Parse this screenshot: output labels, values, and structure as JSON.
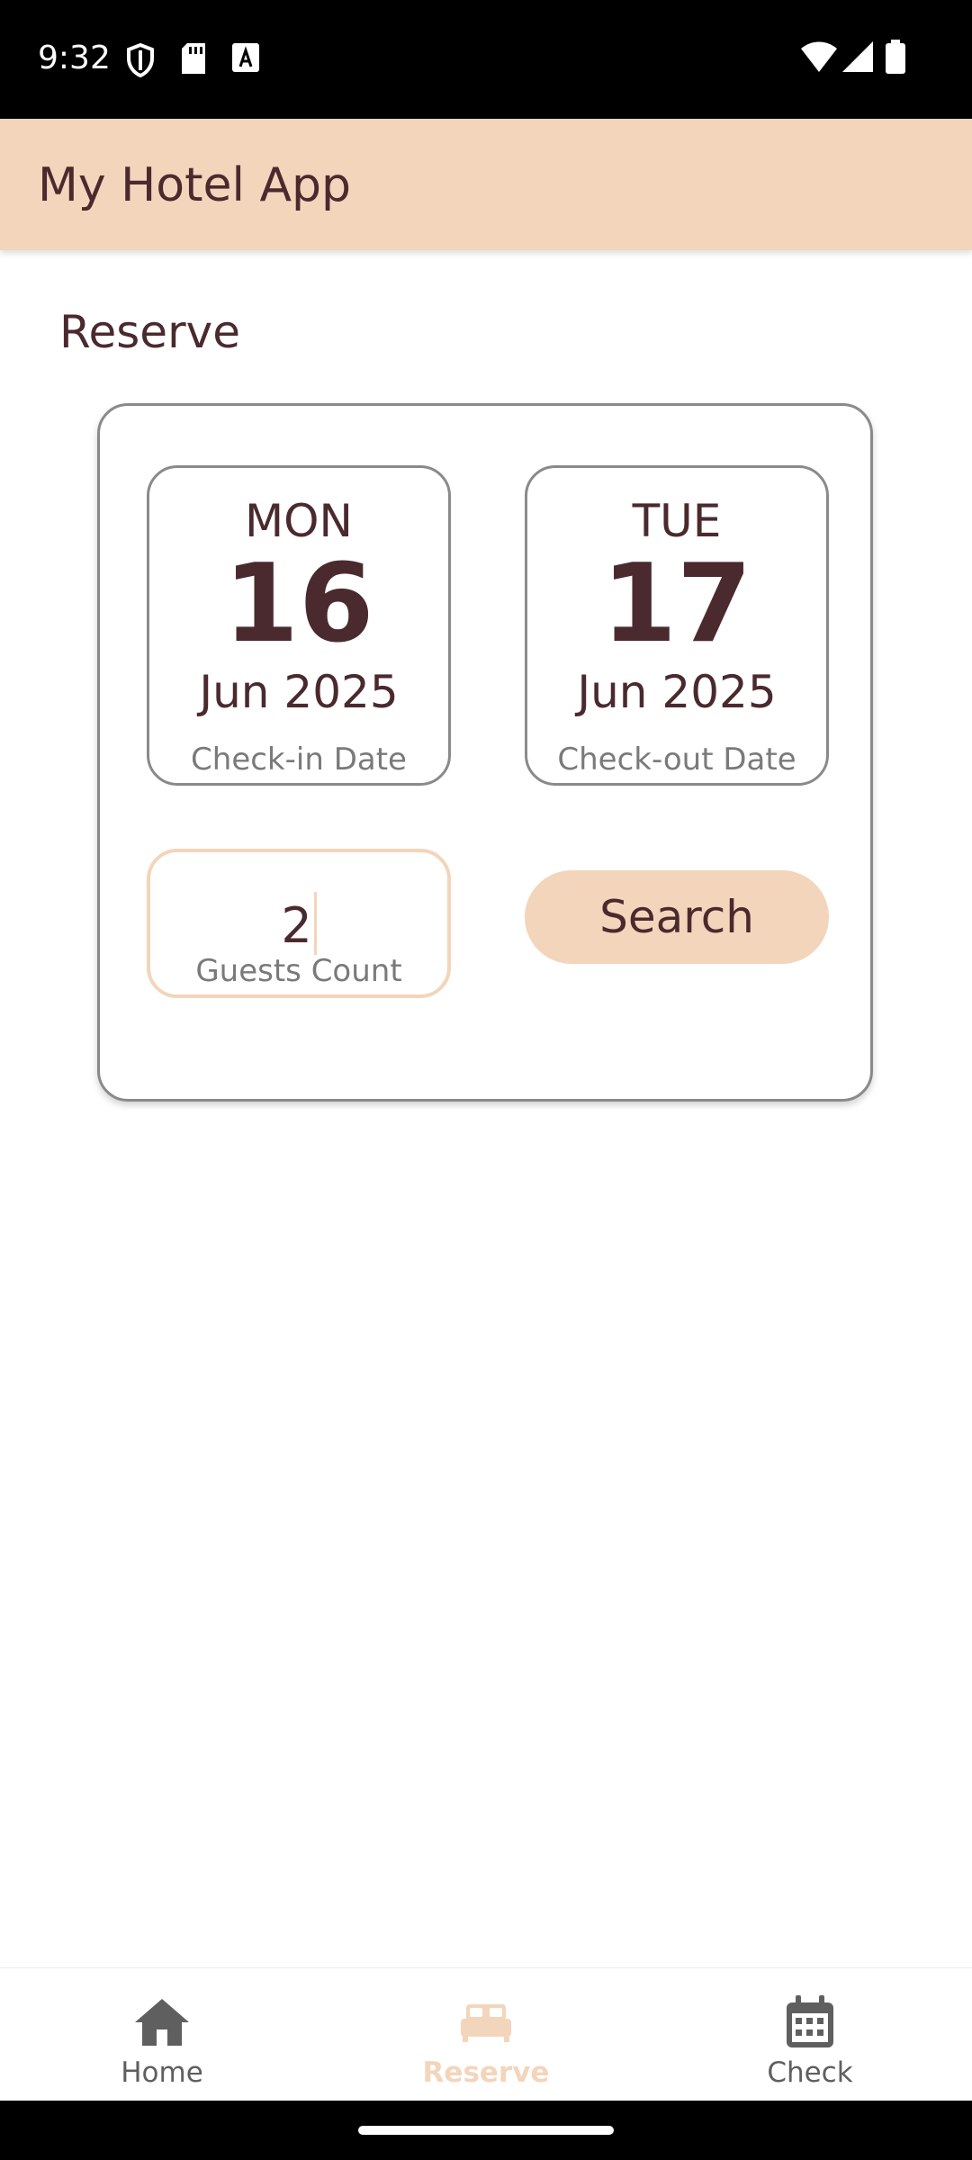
{
  "status_bar": {
    "time": "9:32",
    "left_icons": [
      "shield-icon",
      "sd-card-icon",
      "font-a-icon"
    ],
    "right_icons": [
      "wifi-icon",
      "cell-signal-icon",
      "battery-icon"
    ]
  },
  "app_bar": {
    "title": "My Hotel App"
  },
  "section": {
    "title": "Reserve"
  },
  "checkin": {
    "dow": "MON",
    "day": "16",
    "month_year": "Jun 2025",
    "label": "Check-in Date"
  },
  "checkout": {
    "dow": "TUE",
    "day": "17",
    "month_year": "Jun 2025",
    "label": "Check-out Date"
  },
  "guests": {
    "value": "2",
    "label": "Guests Count"
  },
  "search": {
    "label": "Search"
  },
  "bottom_nav": {
    "items": [
      {
        "label": "Home",
        "icon": "home-icon",
        "active": false
      },
      {
        "label": "Reserve",
        "icon": "bed-icon",
        "active": true
      },
      {
        "label": "Check",
        "icon": "calendar-icon",
        "active": false
      }
    ]
  },
  "colors": {
    "accent": "#f3d5bb",
    "text": "#4a2a2e",
    "muted": "#7a7a7a",
    "border": "#8a8a8a"
  }
}
